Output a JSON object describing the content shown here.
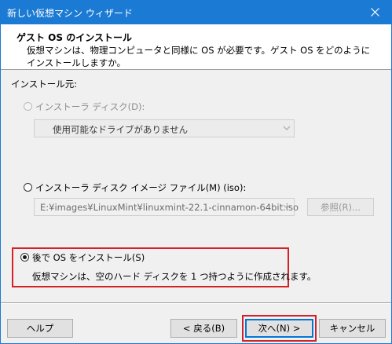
{
  "window": {
    "title": "新しい仮想マシン ウィザード"
  },
  "header": {
    "title": "ゲスト OS のインストール",
    "description": "仮想マシンは、物理コンピュータと同様に OS が必要です。ゲスト OS をどのようにインストールしますか。"
  },
  "install_source_label": "インストール元:",
  "option_disc": {
    "label": "インストーラ ディスク(D):",
    "combo_value": "使用可能なドライブがありません"
  },
  "option_iso": {
    "label": "インストーラ ディスク イメージ ファイル(M) (iso):",
    "path_value": "E:¥images¥LinuxMint¥linuxmint-22.1-cinnamon-64bit.iso",
    "browse_label": "参照(R)..."
  },
  "option_later": {
    "label": "後で OS をインストール(S)",
    "description": "仮想マシンは、空のハード ディスクを 1 つ持つように作成されます。"
  },
  "buttons": {
    "help": "ヘルプ",
    "back": "< 戻る(B)",
    "next": "次へ(N) >",
    "cancel": "キャンセル"
  },
  "colors": {
    "titlebar": "#1b7ad3",
    "highlight": "#d62027"
  }
}
